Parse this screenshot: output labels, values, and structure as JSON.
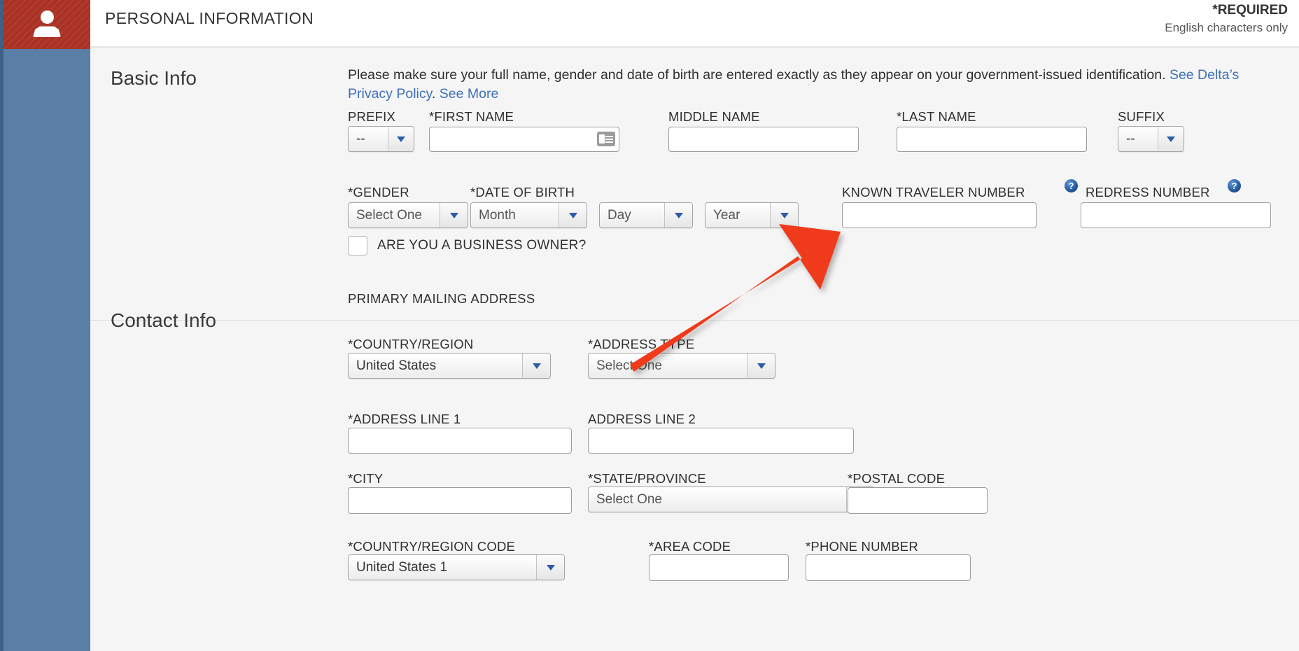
{
  "header": {
    "title": "PERSONAL INFORMATION",
    "required_note": "*REQUIRED",
    "english_note": "English characters only"
  },
  "sidebar": {
    "avatar_icon": "person-icon"
  },
  "basic_info": {
    "section_title": "Basic Info",
    "intro_text_1": "Please make sure your full name, gender and date of birth are entered exactly as they appear on your government-issued identification. ",
    "privacy_link": "See Delta’s Privacy Policy",
    "intro_text_2": ". ",
    "see_more_link": "See More",
    "fields": {
      "prefix_label": "PREFIX",
      "prefix_value": "--",
      "first_name_label": "*FIRST NAME",
      "first_name_value": "",
      "middle_name_label": "MIDDLE NAME",
      "middle_name_value": "",
      "last_name_label": "*LAST NAME",
      "last_name_value": "",
      "suffix_label": "SUFFIX",
      "suffix_value": "--",
      "gender_label": "*GENDER",
      "gender_value": "Select One",
      "dob_label": "*DATE OF BIRTH",
      "dob_month_value": "Month",
      "dob_day_value": "Day",
      "dob_year_value": "Year",
      "known_traveler_label": "KNOWN TRAVELER NUMBER",
      "known_traveler_value": "",
      "redress_label": "REDRESS NUMBER",
      "redress_value": "",
      "help_glyph": "?",
      "business_owner_label": "ARE YOU A BUSINESS OWNER?",
      "business_owner_checked": false
    }
  },
  "contact_info": {
    "section_title": "Contact Info",
    "sub_head": "PRIMARY MAILING ADDRESS",
    "fields": {
      "country_label": "*COUNTRY/REGION",
      "country_value": "United States",
      "address_type_label": "*ADDRESS TYPE",
      "address_type_value": "Select One",
      "address1_label": "*ADDRESS LINE 1",
      "address1_value": "",
      "address2_label": "ADDRESS LINE 2",
      "address2_value": "",
      "city_label": "*CITY",
      "city_value": "",
      "state_label": "*STATE/PROVINCE",
      "state_value": "Select One",
      "postal_label": "*POSTAL CODE",
      "postal_value": "",
      "country_code_label": "*COUNTRY/REGION CODE",
      "country_code_value": "United States 1",
      "area_code_label": "*AREA CODE",
      "area_code_value": "",
      "phone_label": "*PHONE NUMBER",
      "phone_value": ""
    }
  },
  "annotation": {
    "type": "arrow",
    "color": "#ef3b1f",
    "points_to": "known-traveler-number-input"
  },
  "colors": {
    "rail_blue": "#5b7ea6",
    "rail_red": "#a93224",
    "link_blue": "#3f6fb8",
    "panel_bg": "#f5f5f5",
    "arrow_red": "#ef3b1f"
  }
}
